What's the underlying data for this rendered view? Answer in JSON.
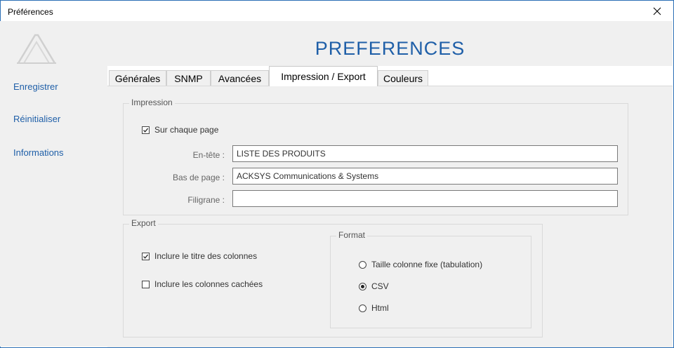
{
  "window": {
    "title": "Préférences"
  },
  "sidebar": {
    "items": [
      {
        "label": "Enregistrer"
      },
      {
        "label": "Réinitialiser"
      },
      {
        "label": "Informations"
      }
    ]
  },
  "header": {
    "title": "PREFERENCES"
  },
  "tabs": [
    {
      "label": "Générales",
      "active": false
    },
    {
      "label": "SNMP",
      "active": false
    },
    {
      "label": "Avancées",
      "active": false
    },
    {
      "label": "Impression / Export",
      "active": true
    },
    {
      "label": "Couleurs",
      "active": false
    }
  ],
  "impression": {
    "legend": "Impression",
    "each_page": {
      "label": "Sur chaque page",
      "checked": true
    },
    "header_field": {
      "label": "En-tête :",
      "value": "LISTE DES PRODUITS"
    },
    "footer_field": {
      "label": "Bas de page :",
      "value": "ACKSYS Communications & Systems"
    },
    "watermark_field": {
      "label": "Filigrane :",
      "value": ""
    }
  },
  "export": {
    "legend": "Export",
    "include_titles": {
      "label": "Inclure le titre des colonnes",
      "checked": true
    },
    "include_hidden": {
      "label": "Inclure les colonnes cachées",
      "checked": false
    },
    "format": {
      "legend": "Format",
      "options": [
        {
          "label": "Taille colonne fixe (tabulation)",
          "selected": false
        },
        {
          "label": "CSV",
          "selected": true
        },
        {
          "label": "Html",
          "selected": false
        }
      ]
    }
  },
  "colors": {
    "accent": "#1f5fa8",
    "panel": "#f0f0f0",
    "border": "#2b6fb5"
  }
}
